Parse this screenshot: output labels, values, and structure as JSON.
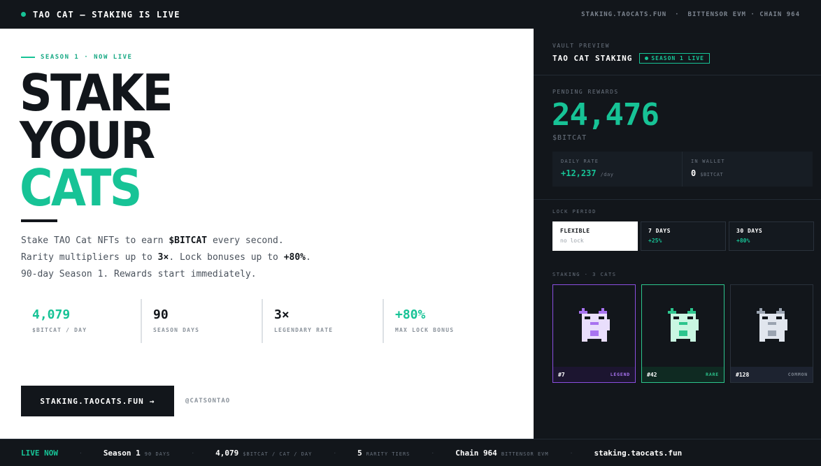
{
  "topbar": {
    "brand": "TAO CAT — STAKING IS LIVE",
    "links": [
      "STAKING.TAOCATS.FUN",
      "BITTENSOR EVM · CHAIN 964"
    ],
    "separator": "·"
  },
  "hero": {
    "season_label": "SEASON 1 · NOW LIVE",
    "headline": [
      "STAKE",
      "YOUR",
      "CATS"
    ],
    "desc": {
      "l1a": "Stake TAO Cat NFTs to earn ",
      "l1b": "$BITCAT",
      "l1c": " every second.",
      "l2a": "Rarity multipliers up to ",
      "l2b": "3×",
      "l2c": ". Lock bonuses up to ",
      "l2d": "+80%",
      "l2e": ".",
      "l3": "90-day Season 1. Rewards start immediately."
    },
    "stats": [
      {
        "value": "4,079",
        "label": "$BITCAT / DAY"
      },
      {
        "value": "90",
        "label": "SEASON DAYS"
      },
      {
        "value": "3×",
        "label": "LEGENDARY RATE"
      },
      {
        "value": "+80%",
        "label": "MAX LOCK BONUS"
      }
    ],
    "cta": "STAKING.TAOCATS.FUN →",
    "handle": "@CATSONTAO"
  },
  "panel": {
    "vault_label": "VAULT PREVIEW",
    "vault_title": "TAO CAT STAKING",
    "badge": "SEASON 1 LIVE",
    "pending_label": "PENDING REWARDS",
    "pending_value": "24,476",
    "pending_unit": "$BITCAT",
    "daily_rate_label": "DAILY RATE",
    "daily_rate_value": "+12,237",
    "daily_rate_unit": "/day",
    "wallet_label": "IN WALLET",
    "wallet_value": "0",
    "wallet_unit": "$BITCAT",
    "lock_label": "LOCK PERIOD",
    "locks": [
      {
        "title": "FLEXIBLE",
        "sub": "no lock"
      },
      {
        "title": "7 DAYS",
        "sub": "+25%"
      },
      {
        "title": "30 DAYS",
        "sub": "+80%"
      }
    ],
    "staking_label": "STAKING · 3 CATS",
    "cats": [
      {
        "id": "#7",
        "tier": "LEGEND"
      },
      {
        "id": "#42",
        "tier": "RARE"
      },
      {
        "id": "#128",
        "tier": "COMMON"
      }
    ]
  },
  "ticker": {
    "live": "LIVE NOW",
    "sep": "·",
    "items": [
      {
        "bold": "Season 1",
        "small": "90 DAYS"
      },
      {
        "bold": "4,079",
        "small": "$BITCAT / CAT / DAY"
      },
      {
        "bold": "5",
        "small": "RARITY TIERS"
      },
      {
        "bold": "Chain 964",
        "small": "BITTENSOR EVM"
      },
      {
        "bold": "staking.taocats.fun",
        "small": ""
      }
    ]
  },
  "colors": {
    "accent": "#17c396",
    "legend": "#8a4fe0",
    "rare": "#2cc58d",
    "common": "#7d8590",
    "dark": "#12161b"
  },
  "icons": [
    "live-dot-icon",
    "cat-pixel-icon"
  ]
}
